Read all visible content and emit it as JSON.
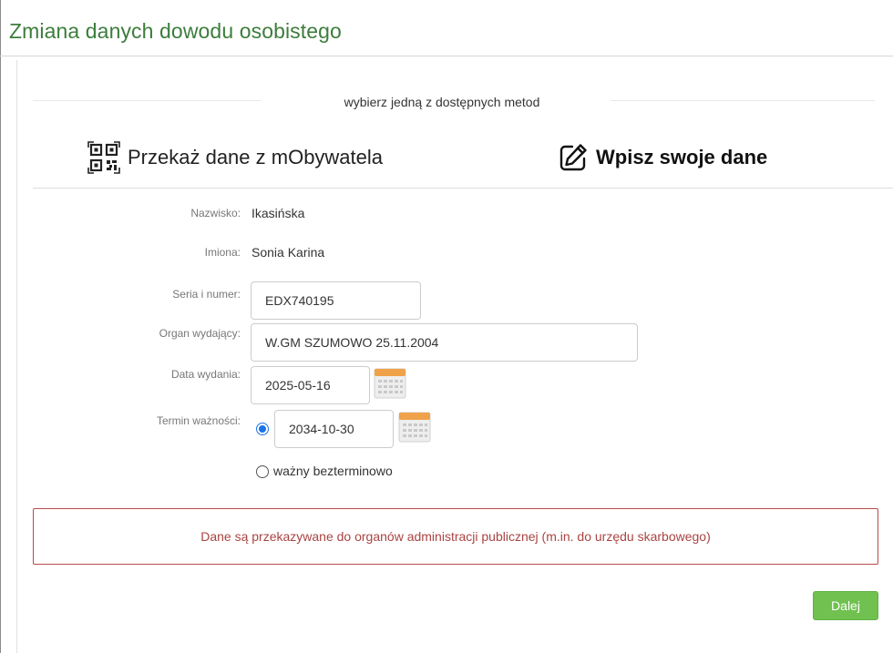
{
  "page": {
    "title": "Zmiana danych dowodu osobistego"
  },
  "methods": {
    "caption": "wybierz jedną z dostępnych metod",
    "mobywatel_label": "Przekaż dane z mObywatela",
    "mobywatel_icon": "qr-code-icon",
    "manual_label": "Wpisz swoje dane",
    "manual_icon": "pencil-edit-icon",
    "selected": "manual"
  },
  "form": {
    "surname_label": "Nazwisko:",
    "surname_value": "Ikasińska",
    "names_label": "Imiona:",
    "names_value": "Sonia Karina",
    "series_label": "Seria i numer:",
    "series_value": "EDX740195",
    "issuer_label": "Organ wydający:",
    "issuer_value": "W.GM SZUMOWO 25.11.2004",
    "issue_date_label": "Data wydania:",
    "issue_date_value": "2025-05-16",
    "expiry_label": "Termin ważności:",
    "expiry_date_value": "2034-10-30",
    "expiry_option_date_selected": true,
    "indefinite_label": "ważny bezterminowo",
    "calendar_icon": "calendar-icon"
  },
  "notice": {
    "text": "Dane są przekazywane do organów administracji publicznej (m.in. do urzędu skarbowego)"
  },
  "actions": {
    "next_label": "Dalej"
  },
  "colors": {
    "title": "#3c7d3c",
    "notice_border": "#b9494b",
    "notice_text": "#a94442",
    "next_button": "#70c150",
    "radio_accent": "#1a73e8",
    "calendar_top": "#f0a24a"
  }
}
